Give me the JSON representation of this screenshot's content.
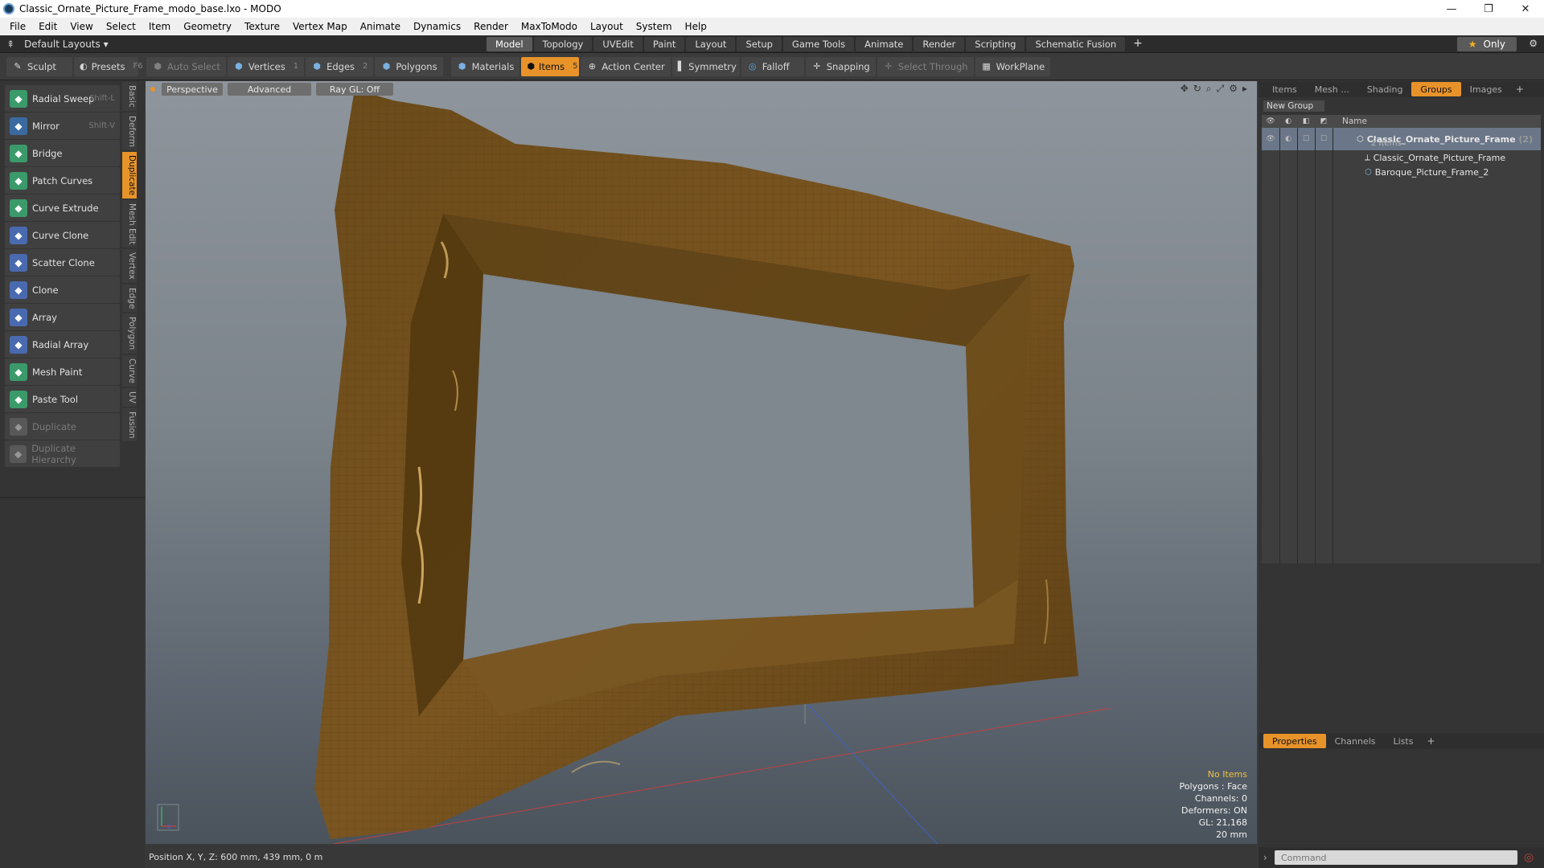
{
  "window": {
    "title": "Classic_Ornate_Picture_Frame_modo_base.lxo - MODO",
    "min": "—",
    "max": "❐",
    "close": "✕"
  },
  "menu": [
    "File",
    "Edit",
    "View",
    "Select",
    "Item",
    "Geometry",
    "Texture",
    "Vertex Map",
    "Animate",
    "Dynamics",
    "Render",
    "MaxToModo",
    "Layout",
    "System",
    "Help"
  ],
  "layout": {
    "selector": "Default Layouts ▾",
    "tabs": [
      "Model",
      "Topology",
      "UVEdit",
      "Paint",
      "Layout",
      "Setup",
      "Game Tools",
      "Animate",
      "Render",
      "Scripting",
      "Schematic Fusion"
    ],
    "active_tab": "Model",
    "add": "+",
    "only": "Only"
  },
  "toolbar": {
    "sculpt": "Sculpt",
    "presets": "Presets",
    "presets_key": "F6",
    "auto_select": "Auto Select",
    "vertices": "Vertices",
    "vertices_count": "1",
    "edges": "Edges",
    "edges_count": "2",
    "polygons": "Polygons",
    "materials": "Materials",
    "items": "Items",
    "items_count": "5",
    "action_center": "Action Center",
    "symmetry": "Symmetry",
    "falloff": "Falloff",
    "snapping": "Snapping",
    "select_through": "Select Through",
    "workplane": "WorkPlane"
  },
  "tools": [
    {
      "label": "Radial Sweep",
      "shortcut": "Shift-L",
      "color": "#3a9a6a"
    },
    {
      "label": "Mirror",
      "shortcut": "Shift-V",
      "color": "#3a6aa0"
    },
    {
      "label": "Bridge",
      "shortcut": "",
      "color": "#3a9a6a"
    },
    {
      "label": "Patch Curves",
      "shortcut": "",
      "color": "#3a9a6a"
    },
    {
      "label": "Curve Extrude",
      "shortcut": "",
      "color": "#3a9a6a"
    },
    {
      "label": "Curve Clone",
      "shortcut": "",
      "color": "#4a6ab0"
    },
    {
      "label": "Scatter Clone",
      "shortcut": "",
      "color": "#4a6ab0"
    },
    {
      "label": "Clone",
      "shortcut": "",
      "color": "#4a6ab0"
    },
    {
      "label": "Array",
      "shortcut": "",
      "color": "#4a6ab0"
    },
    {
      "label": "Radial Array",
      "shortcut": "",
      "color": "#4a6ab0"
    },
    {
      "label": "Mesh Paint",
      "shortcut": "",
      "color": "#3a9a6a"
    },
    {
      "label": "Paste Tool",
      "shortcut": "",
      "color": "#3a9a6a"
    },
    {
      "label": "Duplicate",
      "shortcut": "",
      "color": "#777777"
    },
    {
      "label": "Duplicate Hierarchy",
      "shortcut": "",
      "color": "#777777"
    }
  ],
  "vtabs": [
    "Basic",
    "Deform",
    "Duplicate",
    "Mesh Edit",
    "Vertex",
    "Edge",
    "Polygon",
    "Curve",
    "UV",
    "Fusion"
  ],
  "active_vtab": "Duplicate",
  "viewport": {
    "perspective": "Perspective",
    "advanced": "Advanced",
    "raygl": "Ray GL: Off",
    "stats": {
      "items": "No Items",
      "polygons": "Polygons : Face",
      "channels": "Channels: 0",
      "deformers": "Deformers: ON",
      "gl": "GL: 21,168",
      "size": "20 mm"
    }
  },
  "right_panel": {
    "tabs": [
      "Items",
      "Mesh ...",
      "Shading",
      "Groups",
      "Images"
    ],
    "active_tab": "Groups",
    "new_group": "New Group",
    "name_header": "Name",
    "group": {
      "name": "Classic_Ornate_Picture_Frame",
      "count": "(2)",
      "sub": "2 Items"
    },
    "children": [
      "Classic_Ornate_Picture_Frame",
      "Baroque_Picture_Frame_2"
    ],
    "prop_tabs": [
      "Properties",
      "Channels",
      "Lists"
    ],
    "prop_active": "Properties",
    "command_placeholder": "Command"
  },
  "status": {
    "position": "Position X, Y, Z:  600 mm, 439 mm, 0 m"
  }
}
